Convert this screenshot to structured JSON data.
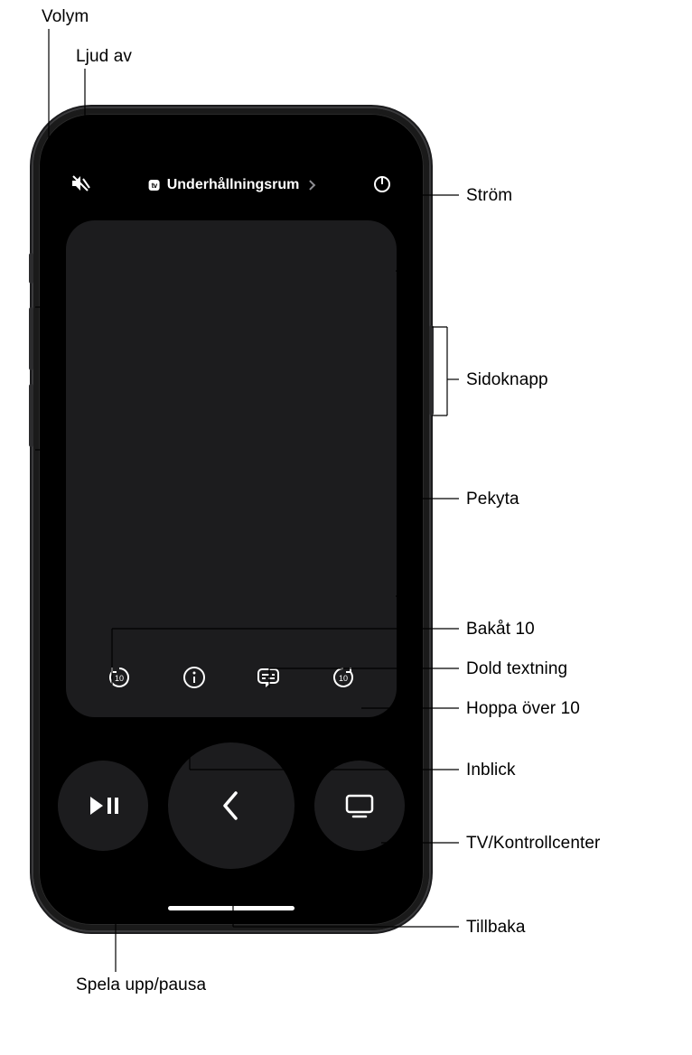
{
  "header": {
    "room_name": "Underhållningsrum",
    "tv_badge": "tv"
  },
  "labels": {
    "volume": "Volym",
    "mute": "Ljud av",
    "power": "Ström",
    "side_button": "Sidoknapp",
    "touch_surface": "Pekyta",
    "back_10": "Bakåt 10",
    "closed_captions": "Dold textning",
    "skip_10": "Hoppa över 10",
    "insight": "Inblick",
    "tv_control_center": "TV/Kontrollcenter",
    "back": "Tillbaka",
    "play_pause": "Spela upp/pausa"
  },
  "icons": {
    "mute": "mute-icon",
    "power": "power-icon",
    "back10": "back-10-icon",
    "info": "info-icon",
    "captions": "captions-icon",
    "forward10": "forward-10-icon",
    "playpause": "play-pause-icon",
    "back_chevron": "chevron-left-icon",
    "tv": "tv-icon",
    "chevron_right": "chevron-right-icon",
    "apple_tv_badge": "apple-tv-badge"
  }
}
